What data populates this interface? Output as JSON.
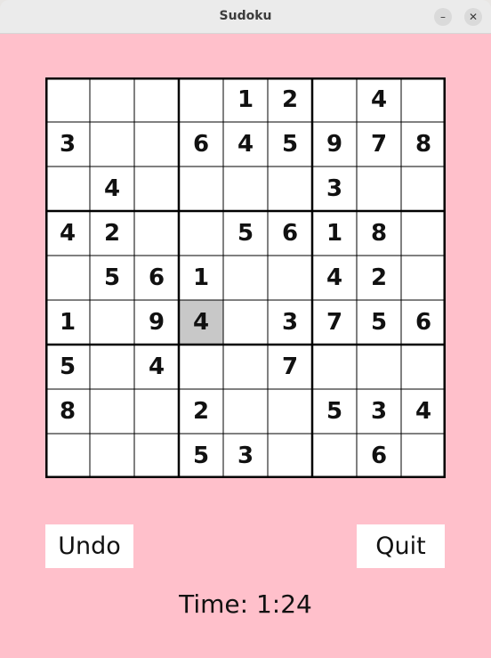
{
  "window": {
    "title": "Sudoku",
    "minimize_glyph": "–",
    "close_glyph": "✕"
  },
  "board": {
    "rows": [
      [
        "",
        "",
        "",
        "",
        "1",
        "2",
        "",
        "4",
        ""
      ],
      [
        "3",
        "",
        "",
        "6",
        "4",
        "5",
        "9",
        "7",
        "8"
      ],
      [
        "",
        "4",
        "",
        "",
        "",
        "",
        "3",
        "",
        ""
      ],
      [
        "4",
        "2",
        "",
        "",
        "5",
        "6",
        "1",
        "8",
        ""
      ],
      [
        "",
        "5",
        "6",
        "1",
        "",
        "",
        "4",
        "2",
        ""
      ],
      [
        "1",
        "",
        "9",
        "4",
        "",
        "3",
        "7",
        "5",
        "6"
      ],
      [
        "5",
        "",
        "4",
        "",
        "",
        "7",
        "",
        "",
        ""
      ],
      [
        "8",
        "",
        "",
        "2",
        "",
        "",
        "5",
        "3",
        "4"
      ],
      [
        "",
        "",
        "",
        "5",
        "3",
        "",
        "",
        "6",
        ""
      ]
    ],
    "selected": {
      "row": 5,
      "col": 3
    }
  },
  "controls": {
    "undo_label": "Undo",
    "quit_label": "Quit"
  },
  "timer": {
    "text": "Time: 1:24"
  },
  "colors": {
    "background": "#ffc0cb",
    "selected_cell": "#c8c8c8",
    "cell": "#ffffff",
    "grid": "#000000"
  }
}
